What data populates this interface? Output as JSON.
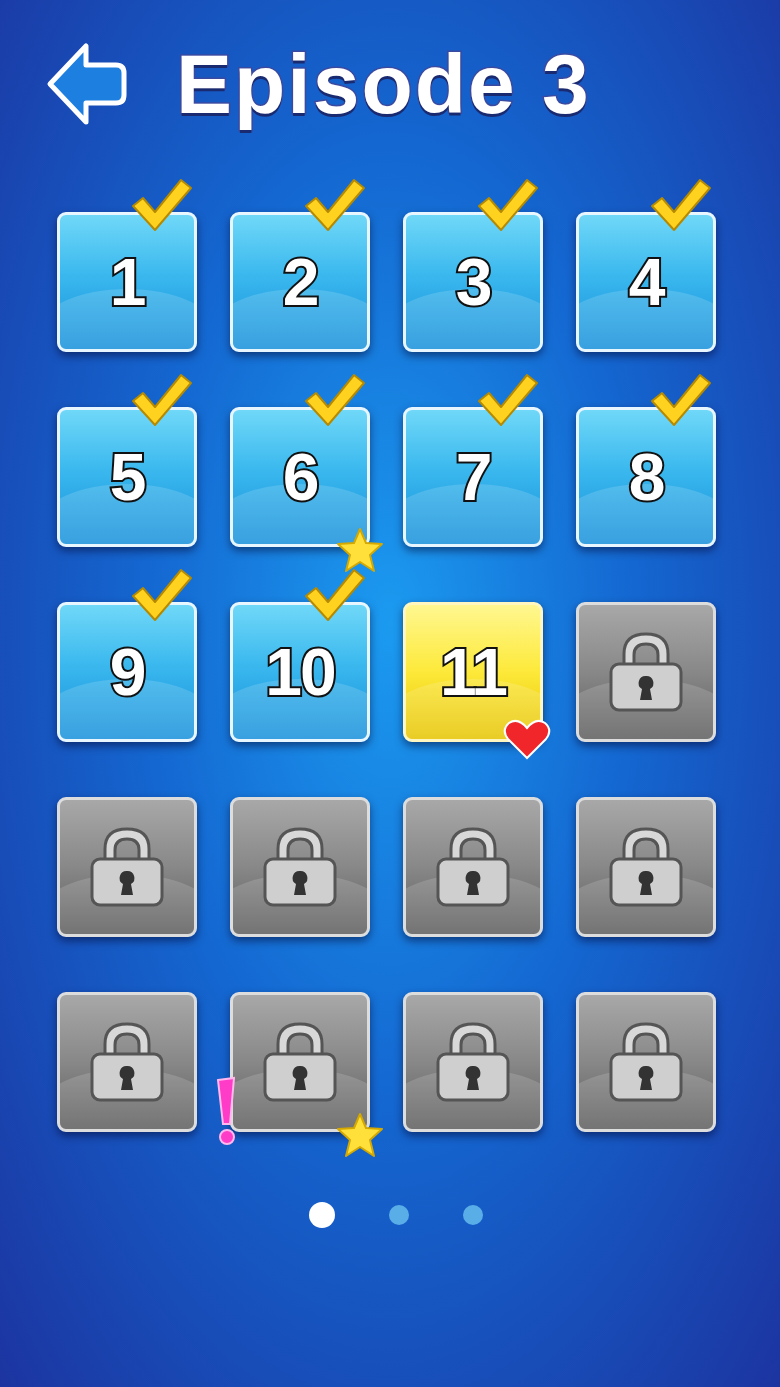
{
  "header": {
    "title": "Episode 3"
  },
  "levels": [
    {
      "number": "1",
      "kind": "done"
    },
    {
      "number": "2",
      "kind": "done"
    },
    {
      "number": "3",
      "kind": "done"
    },
    {
      "number": "4",
      "kind": "done"
    },
    {
      "number": "5",
      "kind": "done"
    },
    {
      "number": "6",
      "kind": "done",
      "badges": [
        {
          "kind": "star"
        }
      ]
    },
    {
      "number": "7",
      "kind": "done"
    },
    {
      "number": "8",
      "kind": "done"
    },
    {
      "number": "9",
      "kind": "done"
    },
    {
      "number": "10",
      "kind": "done"
    },
    {
      "number": "11",
      "kind": "current",
      "badges": [
        {
          "kind": "heart"
        }
      ]
    },
    {
      "kind": "locked"
    },
    {
      "kind": "locked"
    },
    {
      "kind": "locked"
    },
    {
      "kind": "locked"
    },
    {
      "kind": "locked"
    },
    {
      "kind": "locked"
    },
    {
      "kind": "locked",
      "badges": [
        {
          "kind": "alert"
        },
        {
          "kind": "star"
        }
      ]
    },
    {
      "kind": "locked"
    },
    {
      "kind": "locked"
    }
  ],
  "pages": [
    {
      "selected": true
    },
    {
      "selected": false
    },
    {
      "selected": false
    }
  ]
}
